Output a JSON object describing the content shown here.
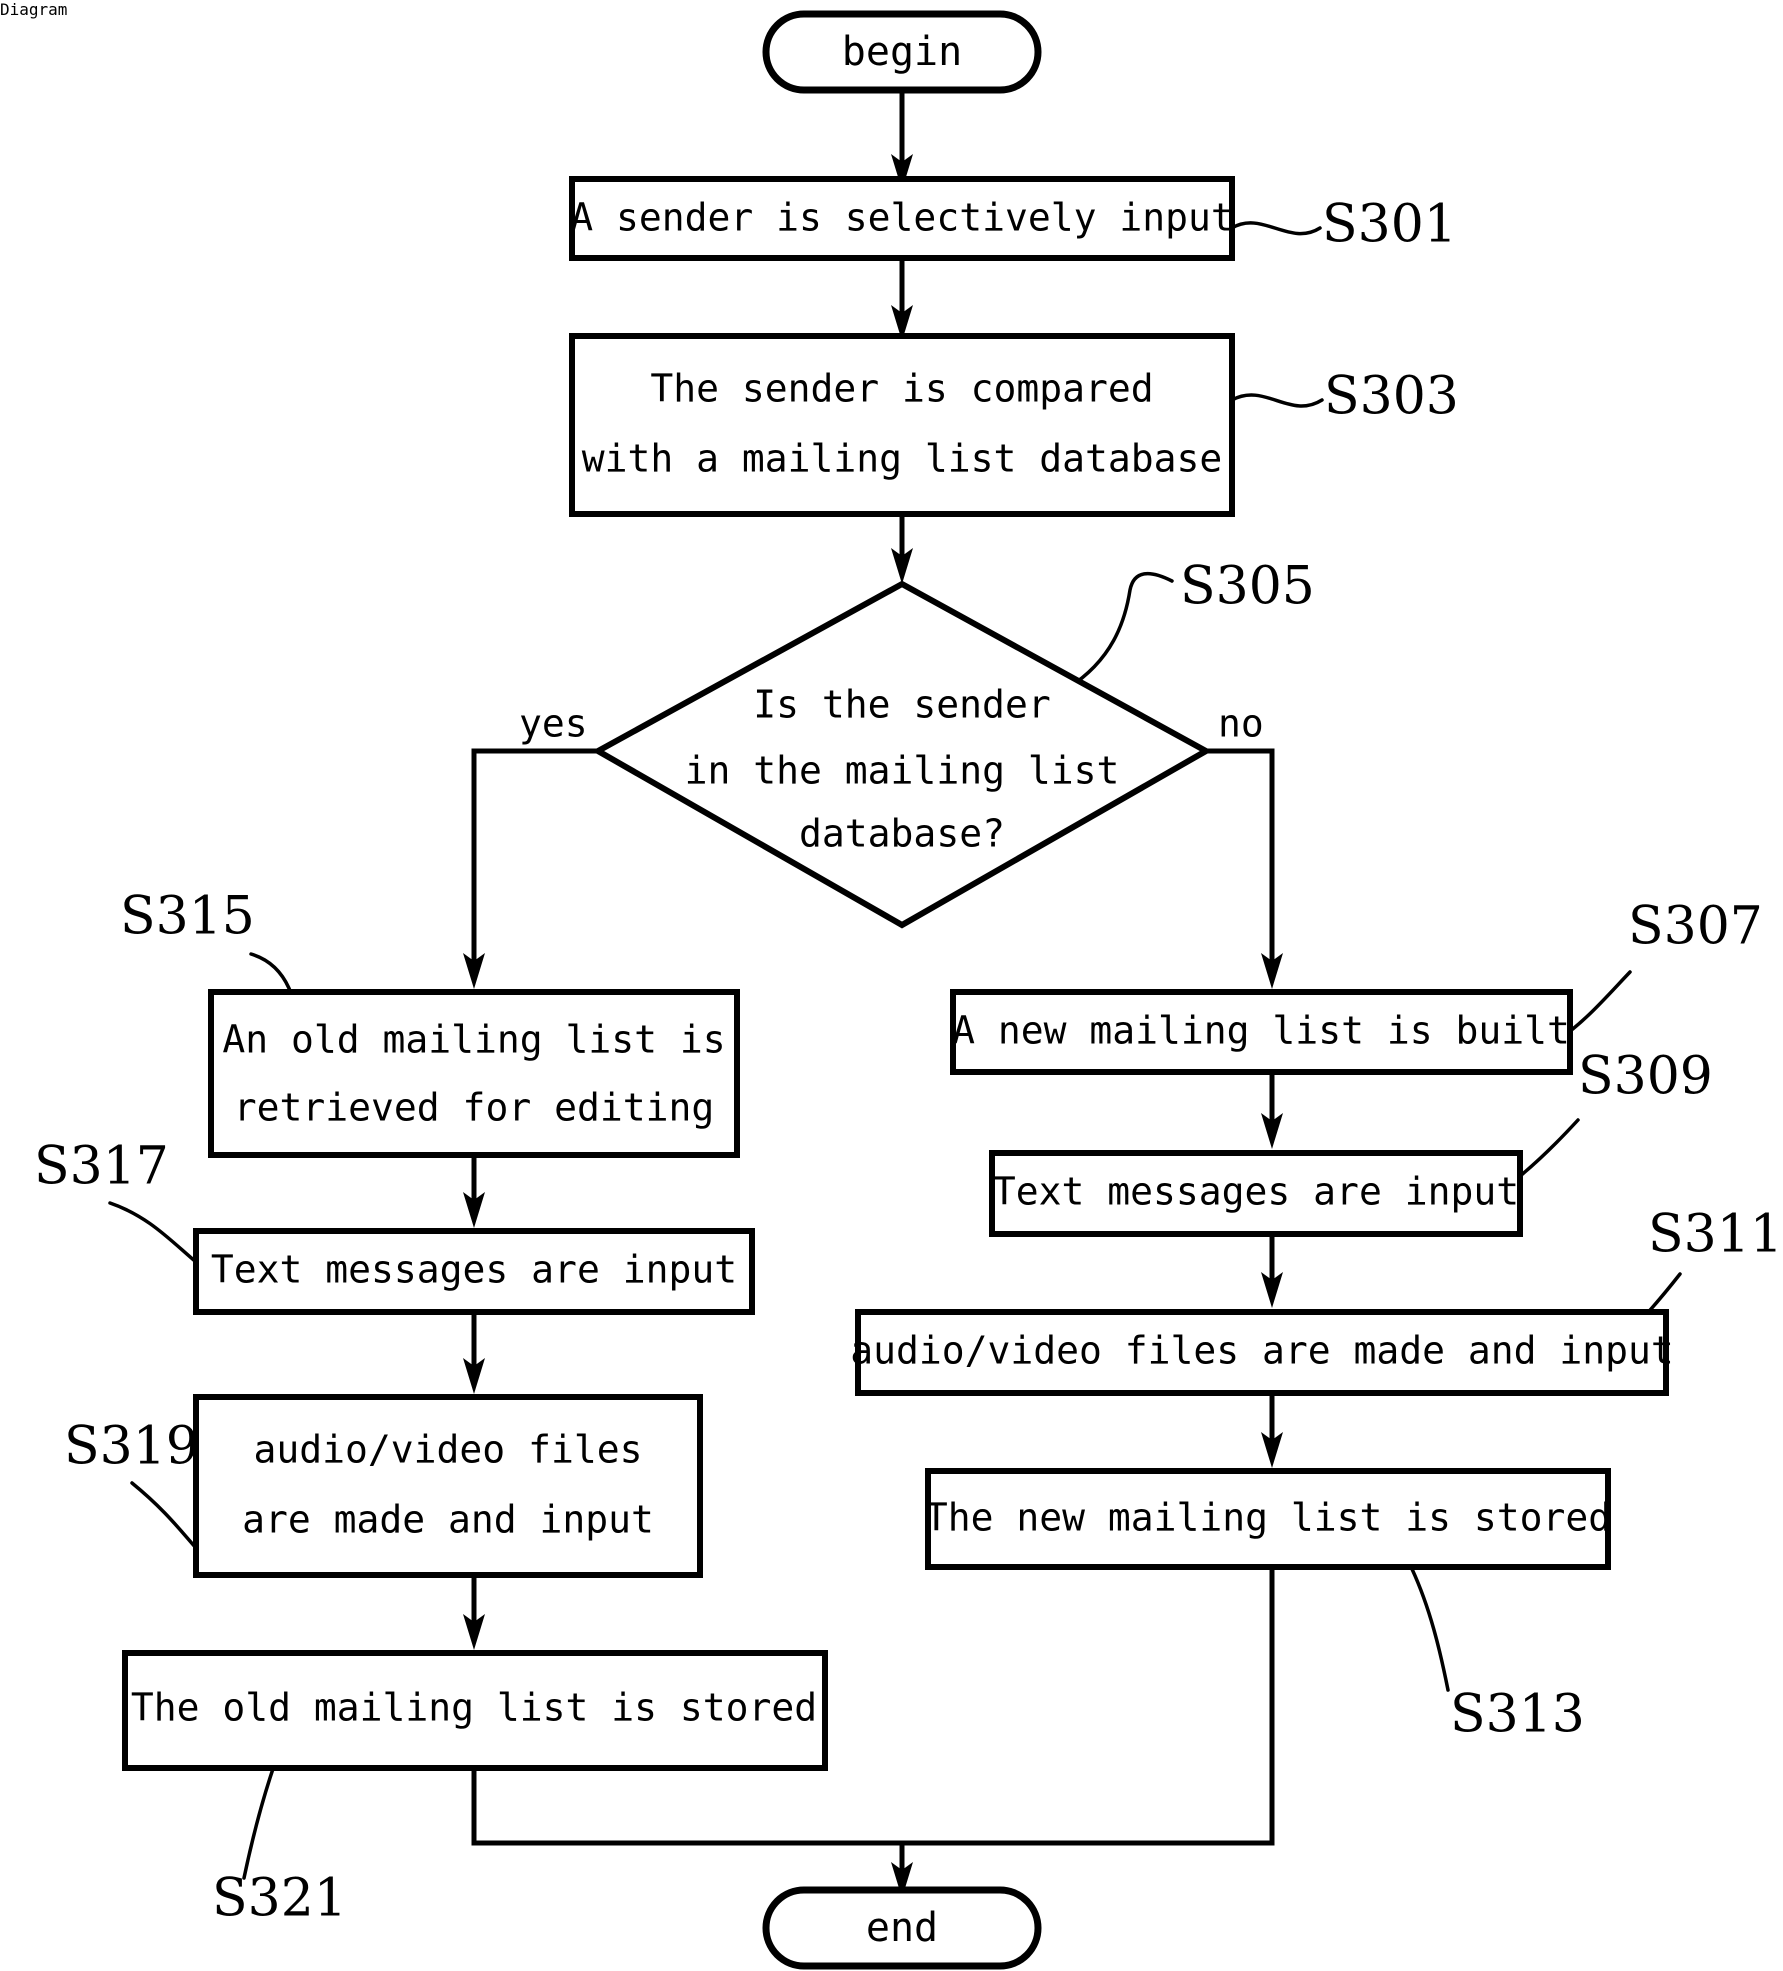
{
  "diagram": {
    "type": "flowchart",
    "title": "",
    "terminators": {
      "begin": "begin",
      "end": "end"
    },
    "branch_labels": {
      "yes": "yes",
      "no": "no"
    },
    "decision": {
      "ref": "S305",
      "line1": "Is the sender",
      "line2": "in the mailing list",
      "line3": "database?"
    },
    "steps": {
      "s301": {
        "ref": "S301",
        "line1": "A sender is selectively input",
        "line2": ""
      },
      "s303": {
        "ref": "S303",
        "line1": "The sender is compared",
        "line2": "with a mailing list database"
      },
      "s315": {
        "ref": "S315",
        "line1": "An old mailing list is",
        "line2": "retrieved for editing"
      },
      "s317": {
        "ref": "S317",
        "line1": "Text messages are input",
        "line2": ""
      },
      "s319": {
        "ref": "S319",
        "line1": "audio/video files",
        "line2": "are made and input"
      },
      "s321": {
        "ref": "S321",
        "line1": "The old mailing list is stored",
        "line2": ""
      },
      "s307": {
        "ref": "S307",
        "line1": "A new mailing list is built",
        "line2": ""
      },
      "s309": {
        "ref": "S309",
        "line1": "Text messages are input",
        "line2": ""
      },
      "s311": {
        "ref": "S311",
        "line1": "audio/video files are made and input",
        "line2": ""
      },
      "s313": {
        "ref": "S313",
        "line1": "The new mailing list is stored",
        "line2": ""
      }
    },
    "colors": {
      "stroke": "#000000",
      "fill": "#ffffff",
      "background": "#ffffff"
    }
  }
}
